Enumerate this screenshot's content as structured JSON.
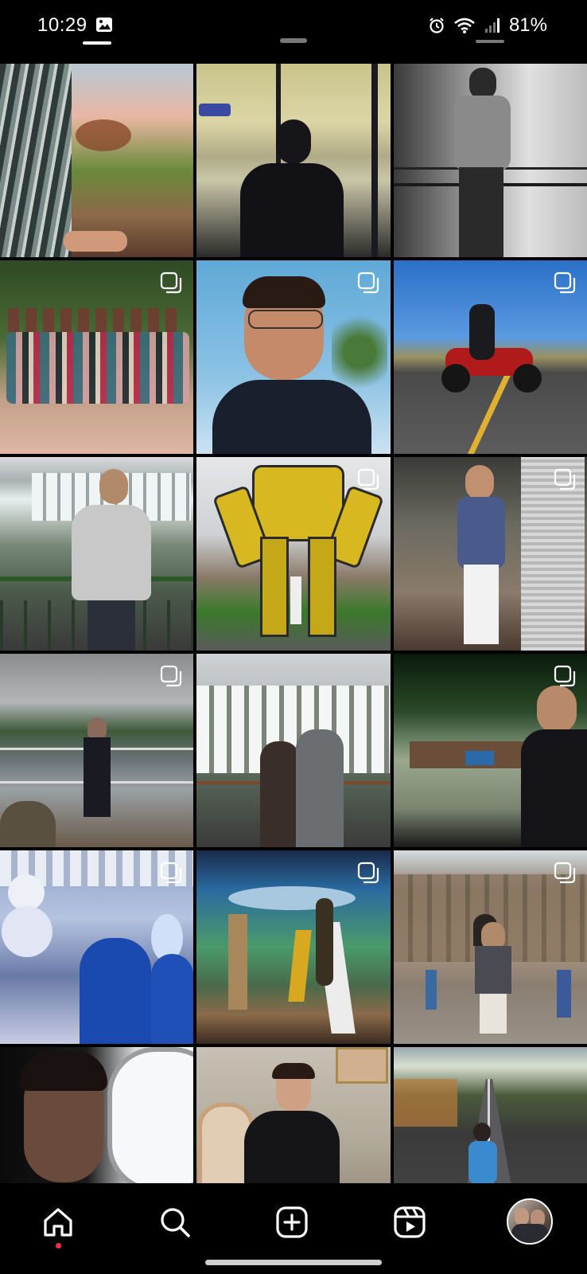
{
  "status_bar": {
    "time": "10:29",
    "battery": "81%",
    "icons": [
      "gallery-icon",
      "alarm-icon",
      "wifi-icon",
      "signal-icon"
    ]
  },
  "grid": {
    "posts": [
      {
        "id": 1,
        "desc": "hammock-feet-sunset",
        "multi": false
      },
      {
        "id": 2,
        "desc": "airport-window-silhouette",
        "multi": false
      },
      {
        "id": 3,
        "desc": "waterfall-railing-bw",
        "multi": false
      },
      {
        "id": 4,
        "desc": "family-group-outdoors",
        "multi": true
      },
      {
        "id": 5,
        "desc": "selfie-glasses-sky",
        "multi": true
      },
      {
        "id": 6,
        "desc": "motorcycle-road",
        "multi": true
      },
      {
        "id": 7,
        "desc": "waterfalls-hoodie",
        "multi": false
      },
      {
        "id": 8,
        "desc": "transformer-statue",
        "multi": true
      },
      {
        "id": 9,
        "desc": "mall-white-pants",
        "multi": true
      },
      {
        "id": 10,
        "desc": "river-cloudy-deck",
        "multi": true
      },
      {
        "id": 11,
        "desc": "couple-waterfalls",
        "multi": false
      },
      {
        "id": 12,
        "desc": "car-interior-night",
        "multi": true
      },
      {
        "id": 13,
        "desc": "ice-bar-snowman",
        "multi": true
      },
      {
        "id": 14,
        "desc": "three-borders-landmark",
        "multi": true
      },
      {
        "id": 15,
        "desc": "historic-building-plaza",
        "multi": true
      },
      {
        "id": 16,
        "desc": "airplane-window-portrait",
        "multi": false
      },
      {
        "id": 17,
        "desc": "seated-portrait-indoor",
        "multi": false
      },
      {
        "id": 18,
        "desc": "rural-road-sitting",
        "multi": false
      }
    ]
  },
  "nav": {
    "items": [
      "home-icon",
      "search-icon",
      "create-icon",
      "reels-icon",
      "profile-avatar"
    ],
    "active": "home-icon",
    "notification_color": "#ff2e4a"
  }
}
